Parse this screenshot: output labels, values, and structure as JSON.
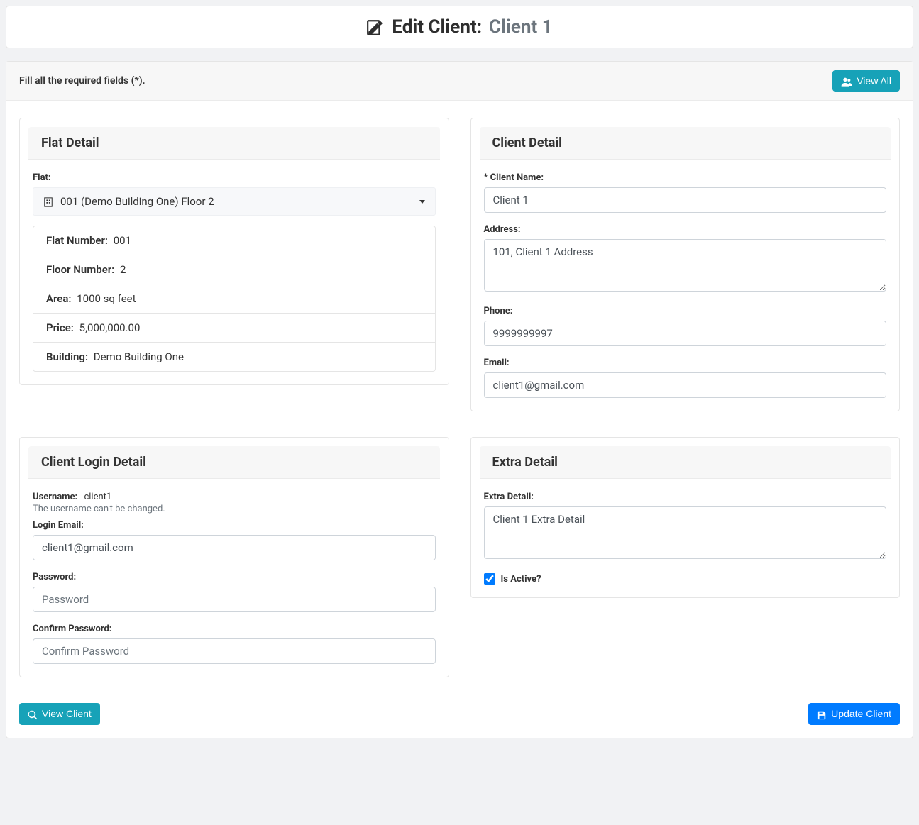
{
  "header": {
    "title_prefix": "Edit Client:",
    "client_name": "Client 1"
  },
  "topbar": {
    "note": "Fill all the required fields (*).",
    "view_all_label": "View All"
  },
  "flat_detail": {
    "panel_title": "Flat Detail",
    "label": "Flat:",
    "selected": "001  (Demo Building One) Floor 2",
    "rows": {
      "flat_number_label": "Flat Number:",
      "flat_number_value": "001",
      "floor_number_label": "Floor Number:",
      "floor_number_value": "2",
      "area_label": "Area:",
      "area_value": "1000 sq feet",
      "price_label": "Price:",
      "price_value": "5,000,000.00",
      "building_label": "Building:",
      "building_value": "Demo Building One"
    }
  },
  "client_detail": {
    "panel_title": "Client Detail",
    "name_label": "* Client Name:",
    "name_value": "Client 1",
    "address_label": "Address:",
    "address_value": "101, Client 1 Address",
    "phone_label": "Phone:",
    "phone_value": "9999999997",
    "email_label": "Email:",
    "email_value": "client1@gmail.com"
  },
  "login_detail": {
    "panel_title": "Client Login Detail",
    "username_label": "Username:",
    "username_value": "client1",
    "username_help": "The username can't be changed.",
    "login_email_label": "Login Email:",
    "login_email_value": "client1@gmail.com",
    "password_label": "Password:",
    "password_placeholder": "Password",
    "confirm_password_label": "Confirm Password:",
    "confirm_password_placeholder": "Confirm Password"
  },
  "extra_detail": {
    "panel_title": "Extra Detail",
    "label": "Extra Detail:",
    "value": "Client 1 Extra Detail",
    "is_active_label": "Is Active?"
  },
  "footer": {
    "view_client_label": "View Client",
    "update_client_label": "Update Client"
  }
}
